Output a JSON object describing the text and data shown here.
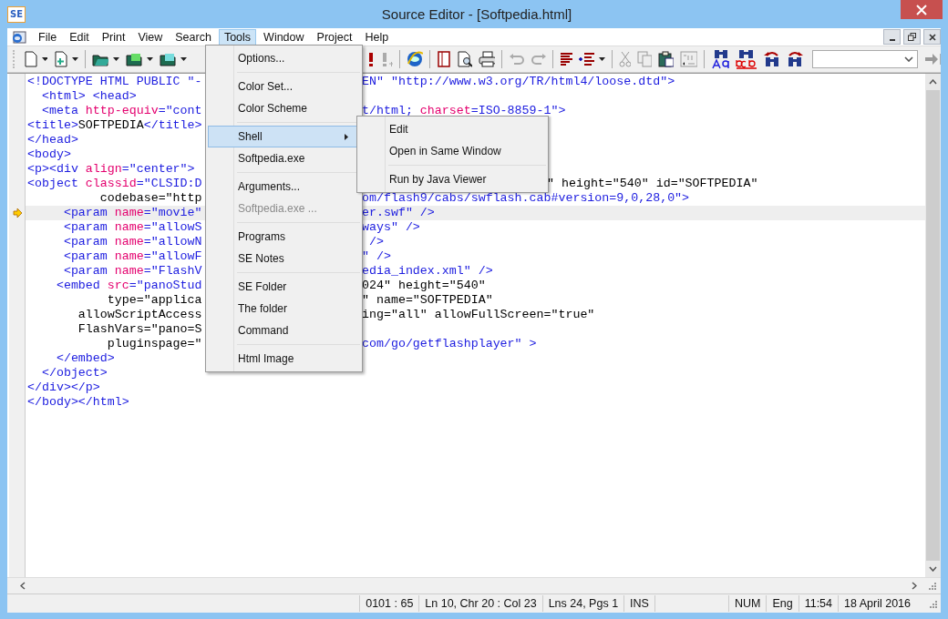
{
  "window": {
    "title": "Source Editor - [Softpedia.html]",
    "icon_text": "SE"
  },
  "menu_bar": [
    {
      "label": "File",
      "selected": false
    },
    {
      "label": "Edit",
      "selected": false
    },
    {
      "label": "Print",
      "selected": false
    },
    {
      "label": "View",
      "selected": false
    },
    {
      "label": "Search",
      "selected": false
    },
    {
      "label": "Tools",
      "selected": true
    },
    {
      "label": "Window",
      "selected": false
    },
    {
      "label": "Project",
      "selected": false
    },
    {
      "label": "Help",
      "selected": false
    }
  ],
  "editor": {
    "lines": [
      {
        "left": "<!DOCTYPE HTML PUBLIC \"-",
        "right": "EN\" \"http://www.w3.org/TR/html4/loose.dtd\">",
        "current": false
      },
      {
        "left": "  <html> <head>",
        "current": false
      },
      {
        "left": "  <meta http-equiv=\"cont",
        "right": "t/html; charset=ISO-8859-1\">",
        "current": false
      },
      {
        "left": "<title>SOFTPEDIA</title>",
        "current": false
      },
      {
        "left": "</head>",
        "current": false
      },
      {
        "left": "<body>",
        "current": false
      },
      {
        "left": "<p><div align=\"center\">",
        "current": false
      },
      {
        "left": "<object classid=\"CLSID:D",
        "right": "\" height=\"540\" id=\"SOFTPEDIA\"",
        "current": false
      },
      {
        "left": "          codebase=\"http",
        "right": "om/flash9/cabs/swflash.cab#version=9,0,28,0\">",
        "current": false
      },
      {
        "left": "     <param name=\"movie\"",
        "right": "er.swf\" />",
        "current": true
      },
      {
        "left": "     <param name=\"allowS",
        "right": "ways\" />",
        "current": false
      },
      {
        "left": "     <param name=\"allowN",
        "right": " />",
        "current": false
      },
      {
        "left": "     <param name=\"allowF",
        "right": "\" />",
        "current": false
      },
      {
        "left": "     <param name=\"FlashV",
        "right": "edia_index.xml\" />",
        "current": false
      },
      {
        "left": "    <embed src=\"panoStud",
        "right": "024\" height=\"540\"",
        "current": false
      },
      {
        "left": "           type=\"applica",
        "right": "\" name=\"SOFTPEDIA\"",
        "current": false
      },
      {
        "left": "       allowScriptAccess",
        "right": "ing=\"all\" allowFullScreen=\"true\"",
        "current": false
      },
      {
        "left": "       FlashVars=\"pano=S",
        "current": false
      },
      {
        "left": "           pluginspage=\"",
        "right": "com/go/getflashplayer\" >",
        "current": false
      },
      {
        "left": "    </embed>",
        "current": false
      },
      {
        "left": "  </object>",
        "current": false
      },
      {
        "left": "</div></p>",
        "current": false
      },
      {
        "left": "</body></html>",
        "current": false
      }
    ]
  },
  "tools_menu": [
    {
      "kind": "item",
      "label": "Options...",
      "selected": false,
      "disabled": false,
      "submenu": false
    },
    {
      "kind": "separator"
    },
    {
      "kind": "item",
      "label": "Color Set...",
      "selected": false,
      "disabled": false,
      "submenu": false
    },
    {
      "kind": "item",
      "label": "Color Scheme",
      "selected": false,
      "disabled": false,
      "submenu": false
    },
    {
      "kind": "separator"
    },
    {
      "kind": "item",
      "label": "Shell",
      "selected": true,
      "disabled": false,
      "submenu": true
    },
    {
      "kind": "item",
      "label": "Softpedia.exe",
      "selected": false,
      "disabled": false,
      "submenu": false
    },
    {
      "kind": "separator"
    },
    {
      "kind": "item",
      "label": "Arguments...",
      "selected": false,
      "disabled": false,
      "submenu": false
    },
    {
      "kind": "item",
      "label": "Softpedia.exe ...",
      "selected": false,
      "disabled": true,
      "submenu": false
    },
    {
      "kind": "separator"
    },
    {
      "kind": "item",
      "label": "Programs",
      "selected": false,
      "disabled": false,
      "submenu": false
    },
    {
      "kind": "item",
      "label": "SE Notes",
      "selected": false,
      "disabled": false,
      "submenu": false
    },
    {
      "kind": "separator"
    },
    {
      "kind": "item",
      "label": "SE Folder",
      "selected": false,
      "disabled": false,
      "submenu": false
    },
    {
      "kind": "item",
      "label": "The folder",
      "selected": false,
      "disabled": false,
      "submenu": false
    },
    {
      "kind": "item",
      "label": "Command",
      "selected": false,
      "disabled": false,
      "submenu": false
    },
    {
      "kind": "separator"
    },
    {
      "kind": "item",
      "label": "Html Image",
      "selected": false,
      "disabled": false,
      "submenu": false
    }
  ],
  "shell_submenu": [
    {
      "kind": "item",
      "label": "Edit"
    },
    {
      "kind": "item",
      "label": "Open in Same Window"
    },
    {
      "kind": "separator"
    },
    {
      "kind": "item",
      "label": "Run by Java Viewer"
    }
  ],
  "status_bar": [
    {
      "kind": "text",
      "text": "0101 : 65"
    },
    {
      "kind": "text",
      "text": "Ln 10, Chr 20 : Col 23"
    },
    {
      "kind": "text",
      "text": "Lns 24, Pgs 1"
    },
    {
      "kind": "text",
      "text": "INS"
    },
    {
      "kind": "blank"
    },
    {
      "kind": "text",
      "text": "NUM"
    },
    {
      "kind": "text",
      "text": "Eng"
    },
    {
      "kind": "text",
      "text": "11:54"
    },
    {
      "kind": "text",
      "text": "18 April 2016"
    }
  ]
}
